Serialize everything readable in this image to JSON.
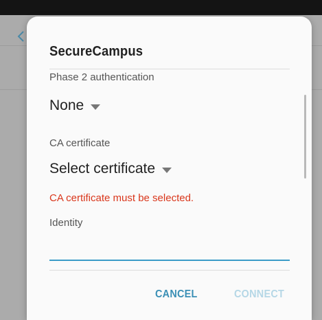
{
  "dialog": {
    "title": "SecureCampus",
    "phase2": {
      "label": "Phase 2 authentication",
      "value": "None"
    },
    "ca_certificate": {
      "label": "CA certificate",
      "value": "Select certificate",
      "error": "CA certificate must be selected."
    },
    "identity": {
      "label": "Identity",
      "value": ""
    },
    "buttons": {
      "cancel": "CANCEL",
      "connect": "CONNECT"
    }
  },
  "colors": {
    "accent": "#3a8fb5",
    "error": "#d9361b",
    "disabled_button": "#b5d7e6"
  },
  "icons": [
    "back-arrow-icon",
    "caret-down-icon"
  ]
}
